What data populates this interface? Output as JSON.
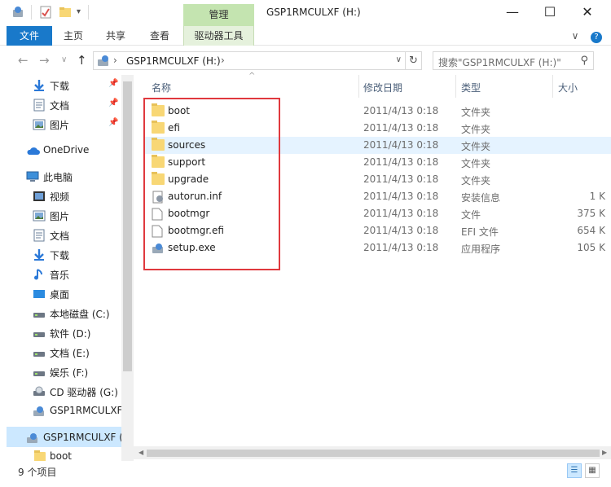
{
  "window": {
    "title": "GSP1RMCULXF (H:)",
    "context_tab_header": "管理",
    "controls": {
      "minimize": "—",
      "maximize": "☐",
      "close": "✕"
    }
  },
  "ribbon": {
    "tabs": [
      "文件",
      "主页",
      "共享",
      "查看",
      "驱动器工具"
    ],
    "expand_glyph": "∨",
    "help_glyph": "?"
  },
  "address": {
    "path_label": "GSP1RMCULXF (H:)",
    "path_sep": "›",
    "search_placeholder": "搜索\"GSP1RMCULXF (H:)\"",
    "back_glyph": "←",
    "forward_glyph": "→",
    "recent_glyph": "∨",
    "up_glyph": "↑",
    "dropdown_glyph": "∨",
    "refresh_glyph": "↻",
    "search_glyph": "⚲"
  },
  "nav_pane": {
    "quick_access": [
      {
        "label": "下载",
        "icon": "download-arrow-icon"
      },
      {
        "label": "文档",
        "icon": "document-icon"
      },
      {
        "label": "图片",
        "icon": "pictures-icon"
      }
    ],
    "pin_glyph": "📌",
    "onedrive": "OneDrive",
    "this_pc": "此电脑",
    "pc_items": [
      {
        "label": "视频",
        "icon": "video-icon"
      },
      {
        "label": "图片",
        "icon": "pictures-icon"
      },
      {
        "label": "文档",
        "icon": "document-icon"
      },
      {
        "label": "下载",
        "icon": "download-arrow-icon"
      },
      {
        "label": "音乐",
        "icon": "music-icon"
      },
      {
        "label": "桌面",
        "icon": "desktop-icon"
      },
      {
        "label": "本地磁盘 (C:)",
        "icon": "drive-icon"
      },
      {
        "label": "软件 (D:)",
        "icon": "drive-icon"
      },
      {
        "label": "文档 (E:)",
        "icon": "drive-icon"
      },
      {
        "label": "娱乐 (F:)",
        "icon": "drive-icon"
      },
      {
        "label": "CD 驱动器 (G:)",
        "icon": "cd-drive-icon"
      },
      {
        "label": "GSP1RMCULXF",
        "icon": "setup-drive-icon"
      }
    ],
    "selected": "GSP1RMCULXF (",
    "sub_item": "boot"
  },
  "columns": {
    "name": "名称",
    "date": "修改日期",
    "type": "类型",
    "size": "大小",
    "sort_glyph": "^"
  },
  "files": [
    {
      "name": "boot",
      "date": "2011/4/13 0:18",
      "type": "文件夹",
      "size": "",
      "kind": "folder"
    },
    {
      "name": "efi",
      "date": "2011/4/13 0:18",
      "type": "文件夹",
      "size": "",
      "kind": "folder"
    },
    {
      "name": "sources",
      "date": "2011/4/13 0:18",
      "type": "文件夹",
      "size": "",
      "kind": "folder",
      "highlight": true
    },
    {
      "name": "support",
      "date": "2011/4/13 0:18",
      "type": "文件夹",
      "size": "",
      "kind": "folder"
    },
    {
      "name": "upgrade",
      "date": "2011/4/13 0:18",
      "type": "文件夹",
      "size": "",
      "kind": "folder"
    },
    {
      "name": "autorun.inf",
      "date": "2011/4/13 0:18",
      "type": "安装信息",
      "size": "1 K",
      "kind": "inf"
    },
    {
      "name": "bootmgr",
      "date": "2011/4/13 0:18",
      "type": "文件",
      "size": "375 K",
      "kind": "file"
    },
    {
      "name": "bootmgr.efi",
      "date": "2011/4/13 0:18",
      "type": "EFI 文件",
      "size": "654 K",
      "kind": "file"
    },
    {
      "name": "setup.exe",
      "date": "2011/4/13 0:18",
      "type": "应用程序",
      "size": "105 K",
      "kind": "exe"
    }
  ],
  "status": {
    "count": "9 个项目"
  },
  "colors": {
    "accent": "#1979ca",
    "context_tab": "#c4e4b0",
    "annotation": "#e0393e"
  }
}
